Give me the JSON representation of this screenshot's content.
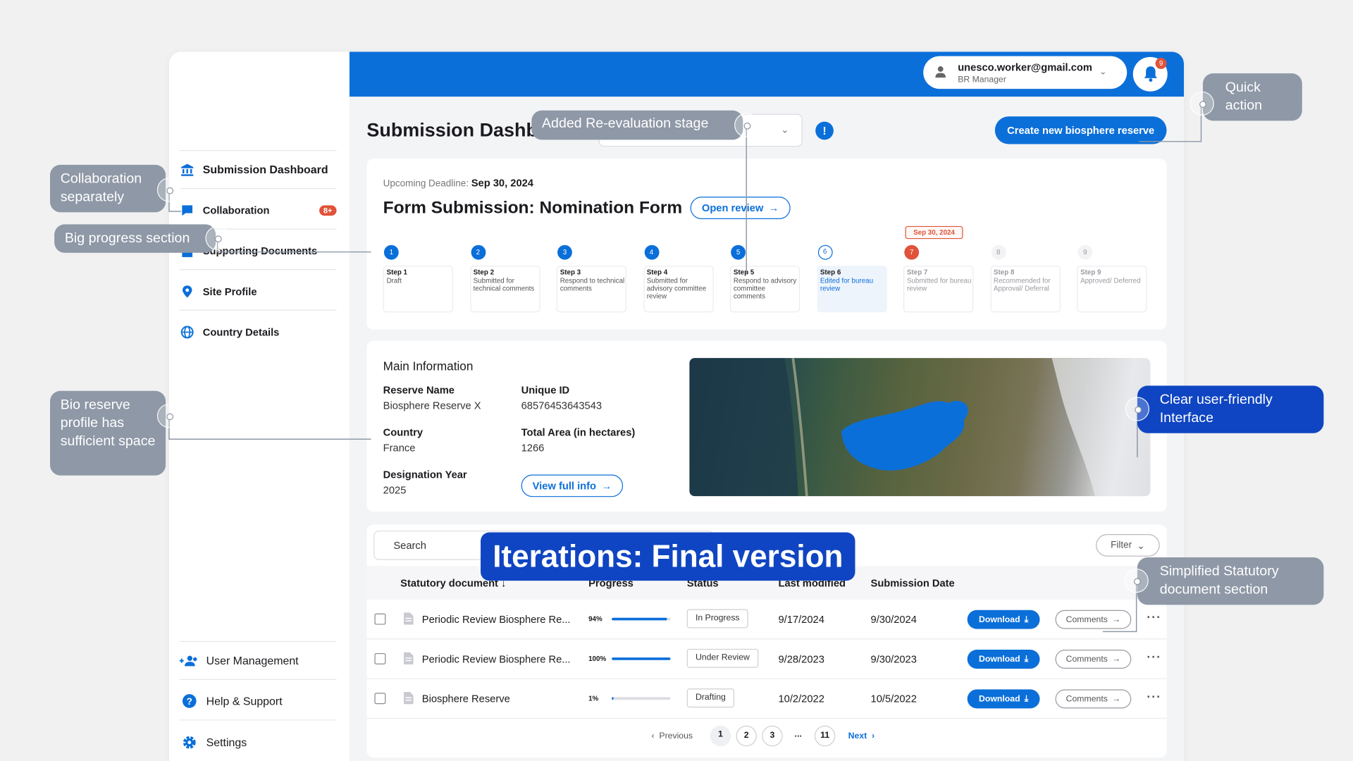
{
  "header": {
    "user_email": "unesco.worker@gmail.com",
    "user_role": "BR Manager",
    "notification_count": "9",
    "page_title": "Submission Dashboard",
    "create_button": "Create new biosphere reserve"
  },
  "sidebar": {
    "items": [
      {
        "label": "Submission Dashboard",
        "icon": "bank-icon"
      },
      {
        "label": "Collaboration",
        "icon": "chat-icon",
        "badge": "8+"
      },
      {
        "label": "Supporting Documents",
        "icon": "document-icon"
      },
      {
        "label": "Site Profile",
        "icon": "location-pin-icon"
      },
      {
        "label": "Country Details",
        "icon": "globe-icon"
      }
    ],
    "bottom_items": [
      {
        "label": "User Management",
        "icon": "users-icon"
      },
      {
        "label": "Help & Support",
        "icon": "help-icon"
      },
      {
        "label": "Settings",
        "icon": "gear-icon"
      }
    ]
  },
  "progress": {
    "deadline_label": "Upcoming Deadline:",
    "deadline_value": "Sep 30, 2024",
    "form_title": "Form Submission: Nomination Form",
    "open_review": "Open review",
    "date_tag": "Sep 30, 2024",
    "steps": [
      {
        "num": "1",
        "name": "Step 1",
        "desc": "Draft",
        "state": "done"
      },
      {
        "num": "2",
        "name": "Step 2",
        "desc": "Submitted for technical comments",
        "state": "done"
      },
      {
        "num": "3",
        "name": "Step 3",
        "desc": "Respond to technical comments",
        "state": "done"
      },
      {
        "num": "4",
        "name": "Step 4",
        "desc": "Submitted for advisory committee review",
        "state": "done"
      },
      {
        "num": "5",
        "name": "Step 5",
        "desc": "Respond to advisory committee comments",
        "state": "done"
      },
      {
        "num": "6",
        "name": "Step 6",
        "desc": "Edited for bureau review",
        "state": "active"
      },
      {
        "num": "7",
        "name": "Step 7",
        "desc": "Submitted for bureau review",
        "state": "deadline"
      },
      {
        "num": "8",
        "name": "Step 8",
        "desc": "Recommended for Approval/ Deferral",
        "state": "future"
      },
      {
        "num": "9",
        "name": "Step 9",
        "desc": "Approved/ Deferred",
        "state": "future"
      }
    ]
  },
  "main_info": {
    "title": "Main Information",
    "reserve_name_label": "Reserve Name",
    "reserve_name": "Biosphere Reserve X",
    "unique_id_label": "Unique ID",
    "unique_id": "68576453643543",
    "country_label": "Country",
    "country": "France",
    "total_area_label": "Total Area (in hectares)",
    "total_area": "1266",
    "designation_year_label": "Designation Year",
    "designation_year": "2025",
    "view_full_info": "View full info"
  },
  "documents": {
    "search_placeholder": "Search",
    "filter_label": "Filter",
    "columns": [
      "Statutory document",
      "Progress",
      "Status",
      "Last modified",
      "Submission Date"
    ],
    "download_label": "Download",
    "comments_label": "Comments",
    "rows": [
      {
        "name": "Periodic Review Biosphere Re...",
        "progress_label": "94%",
        "progress": 0.94,
        "status": "In Progress",
        "modified": "9/17/2024",
        "submitted": "9/30/2024"
      },
      {
        "name": "Periodic Review Biosphere Re...",
        "progress_label": "100%",
        "progress": 1.0,
        "status": "Under Review",
        "modified": "9/28/2023",
        "submitted": "9/30/2023"
      },
      {
        "name": "Biosphere Reserve",
        "progress_label": "1%",
        "progress": 0.01,
        "status": "Drafting",
        "modified": "10/2/2022",
        "submitted": "10/5/2022"
      }
    ],
    "pagination": {
      "previous": "Previous",
      "next": "Next",
      "pages": [
        "1",
        "2",
        "3",
        "...",
        "11"
      ],
      "current": "1"
    }
  },
  "annotations": {
    "re_evaluation": "Added Re-evaluation stage",
    "quick_action": "Quick action",
    "collaboration": "Collaboration separately",
    "progress_section": "Big progress section",
    "bio_profile": "Bio reserve profile has sufficient space",
    "user_friendly": "Clear user-friendly Interface",
    "statutory": "Simplified Statutory document section",
    "banner": "Iterations: Final version"
  },
  "colors": {
    "primary": "#0b6fd9",
    "danger": "#e0533a",
    "annotation_grey": "#8e98a6",
    "annotation_blue": "#0f45c2"
  }
}
